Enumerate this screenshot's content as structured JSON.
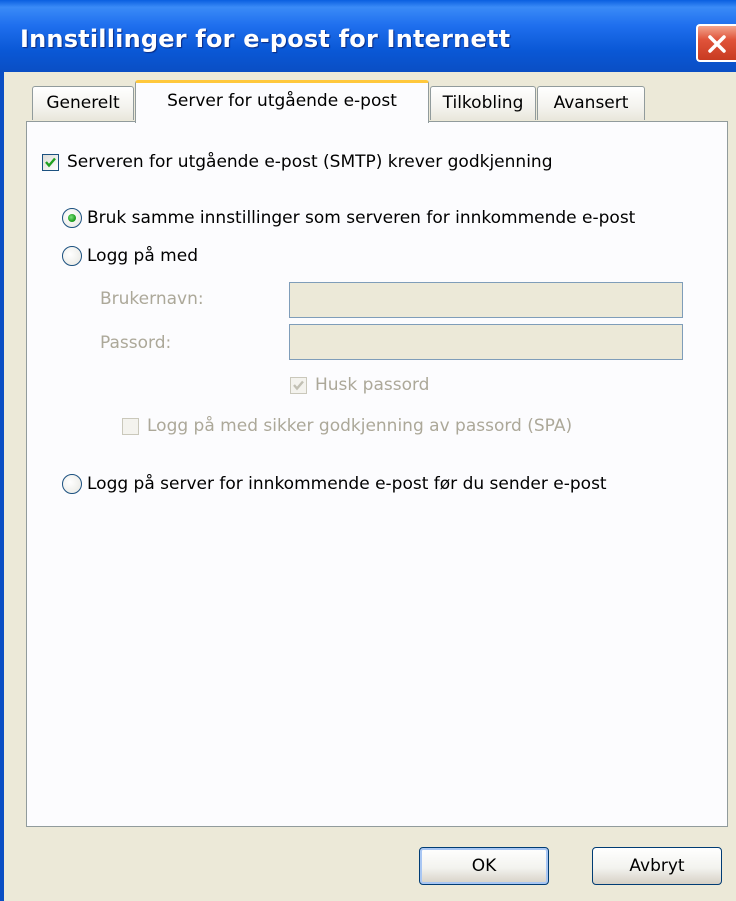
{
  "window": {
    "title": "Innstillinger for e-post for Internett"
  },
  "tabs": [
    {
      "label": "Generelt",
      "active": false
    },
    {
      "label": "Server for utgående e-post",
      "active": true
    },
    {
      "label": "Tilkobling",
      "active": false
    },
    {
      "label": "Avansert",
      "active": false
    }
  ],
  "outgoing": {
    "smtp_auth": {
      "label": "Serveren for utgående e-post (SMTP) krever godkjenning",
      "checked": true
    },
    "radio_same": {
      "label": "Bruk samme innstillinger som serveren for innkommende e-post",
      "selected": true
    },
    "radio_login": {
      "label": "Logg på med",
      "selected": false
    },
    "username_label": "Brukernavn:",
    "username_value": "",
    "password_label": "Passord:",
    "password_value": "",
    "remember_password": {
      "label": "Husk passord",
      "checked": true,
      "enabled": false
    },
    "spa": {
      "label": "Logg på med sikker godkjenning av passord (SPA)",
      "checked": false,
      "enabled": false
    },
    "radio_pop_before": {
      "label": "Logg på server for innkommende e-post før du sender e-post",
      "selected": false
    }
  },
  "buttons": {
    "ok": "OK",
    "cancel": "Avbryt"
  },
  "colors": {
    "titlebar": "#0A58D6",
    "dialog_bg": "#ECE9D8",
    "active_tab_highlight": "#FFC83C",
    "radio_selected": "#21A121",
    "checkmark": "#21A121",
    "close_button": "#E0533A"
  },
  "icons": {
    "close": "close-x-icon",
    "check": "checkmark-icon",
    "radio": "radio-dot-icon"
  }
}
